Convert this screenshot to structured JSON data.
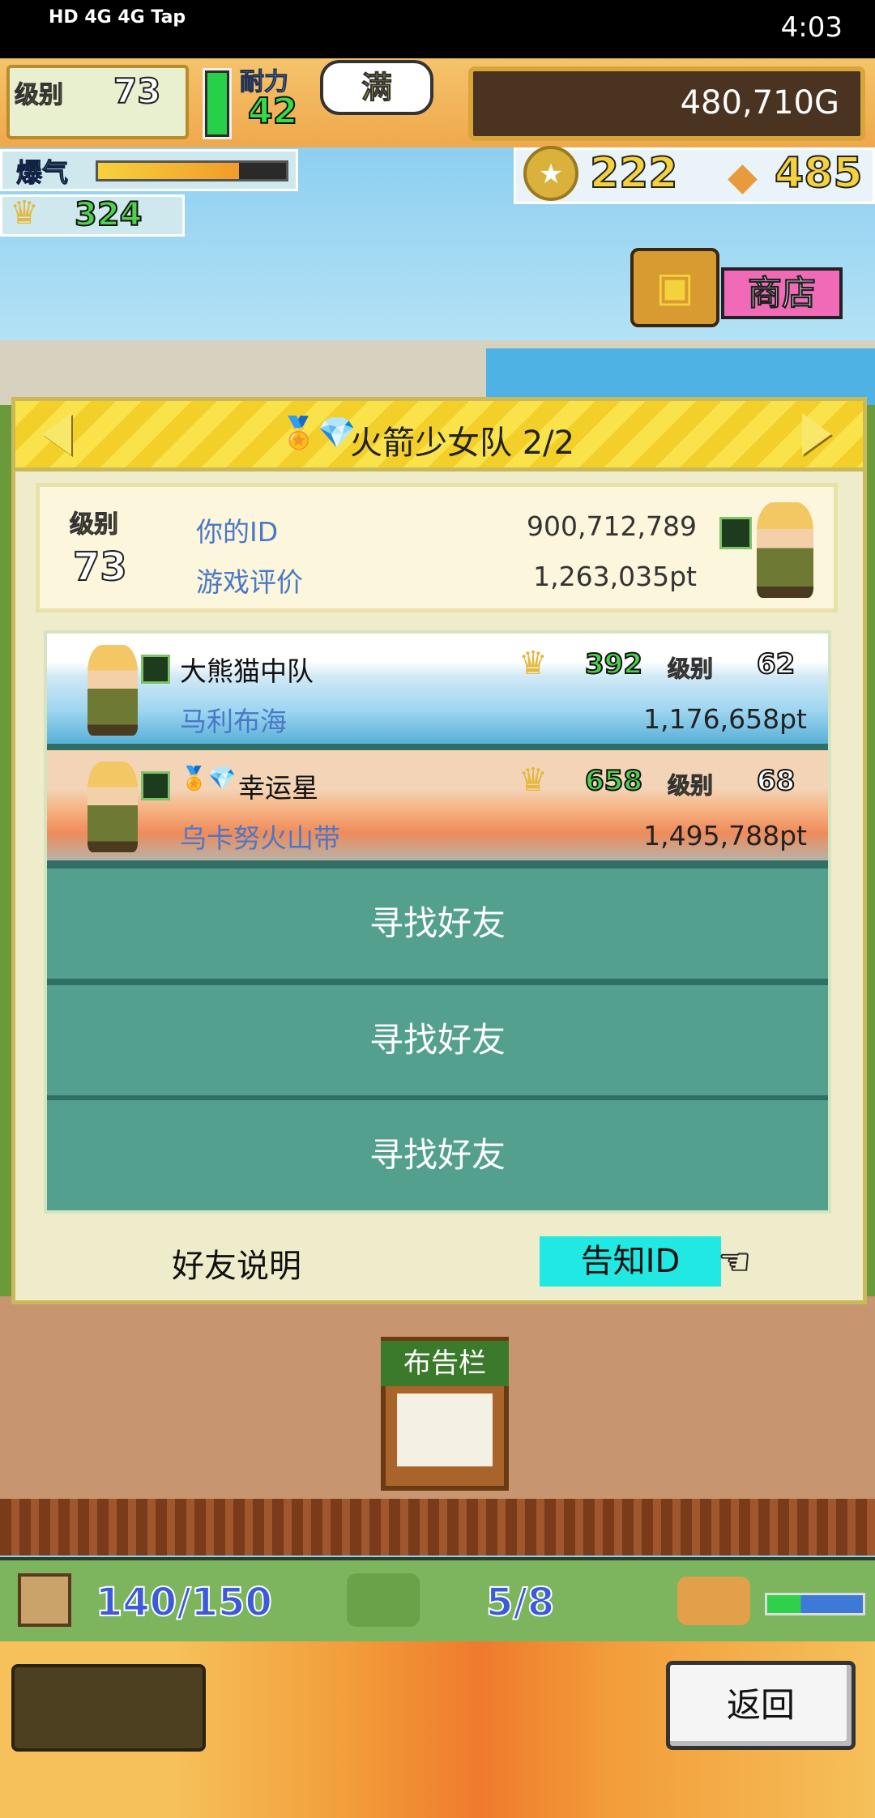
{
  "status_bar": {
    "network": "HD 4G 4G",
    "carrier": "Tap",
    "time": "4:03"
  },
  "hud": {
    "level_label": "级别",
    "level": "73",
    "stamina_label": "耐力",
    "stamina": "42",
    "stamina_full": "满",
    "gold": "480,710G",
    "boost_label": "爆气",
    "boost_fill": 0.75,
    "medals": "324",
    "coins": "222",
    "crates": "485"
  },
  "shop": {
    "label": "商店"
  },
  "panel": {
    "title": "火箭少女队 2/2",
    "profile": {
      "level_label": "级别",
      "level": "73",
      "id_label": "你的ID",
      "id_value": "900,712,789",
      "eval_label": "游戏评价",
      "eval_value": "1,263,035pt"
    },
    "friends": [
      {
        "name": "大熊猫中队",
        "place": "马利布海",
        "medals": "392",
        "level_label": "级别",
        "level": "62",
        "score": "1,176,658pt"
      },
      {
        "name": "幸运星",
        "place": "乌卡努火山带",
        "medals": "658",
        "level_label": "级别",
        "level": "68",
        "score": "1,495,788pt"
      }
    ],
    "slots": [
      "寻找好友",
      "寻找好友",
      "寻找好友"
    ],
    "friend_help": "好友说明",
    "notify_id": "告知ID"
  },
  "board_sign": "布告栏",
  "bottom": {
    "capacity": "140/150",
    "team": "5/8",
    "vehicle_fill": 0.35,
    "back_label": "返回"
  },
  "colors": {
    "accent_yellow": "#f9e24a",
    "list_teal": "#53a08f",
    "notify_cyan": "#22e8e4",
    "link_blue": "#4a78c8"
  }
}
